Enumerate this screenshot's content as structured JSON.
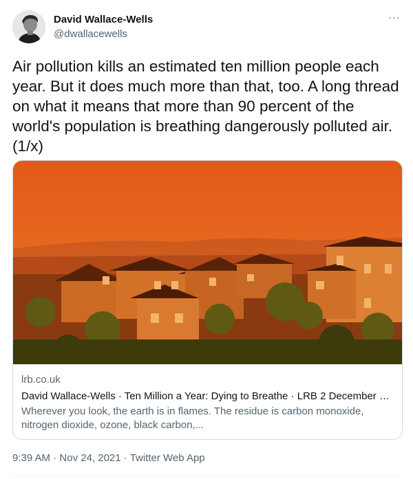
{
  "author": {
    "display_name": "David Wallace-Wells",
    "handle": "@dwallacewells",
    "avatar_icon": "avatar-photo"
  },
  "more_icon": "more-horizontal-icon",
  "more_label": "···",
  "tweet": {
    "text": "Air pollution kills an estimated ten million people each year. But it does much more than that, too. A long thread on what it means that more than 90 percent of the world's population is breathing dangerously polluted air. (1/x)"
  },
  "card": {
    "domain": "lrb.co.uk",
    "title": "David Wallace-Wells · Ten Million a Year: Dying to Breathe · LRB 2 December 2...",
    "description": "Wherever you look, the earth is in flames. The residue is carbon monoxide, nitrogen dioxide, ozone, black carbon,..."
  },
  "meta": {
    "time": "9:39 AM",
    "sep1": " · ",
    "date": "Nov 24, 2021",
    "sep2": " · ",
    "source": "Twitter Web App"
  },
  "colors": {
    "text": "#0f1419",
    "secondary": "#536471",
    "border": "#cfd9de",
    "sky": "#e2621f"
  }
}
